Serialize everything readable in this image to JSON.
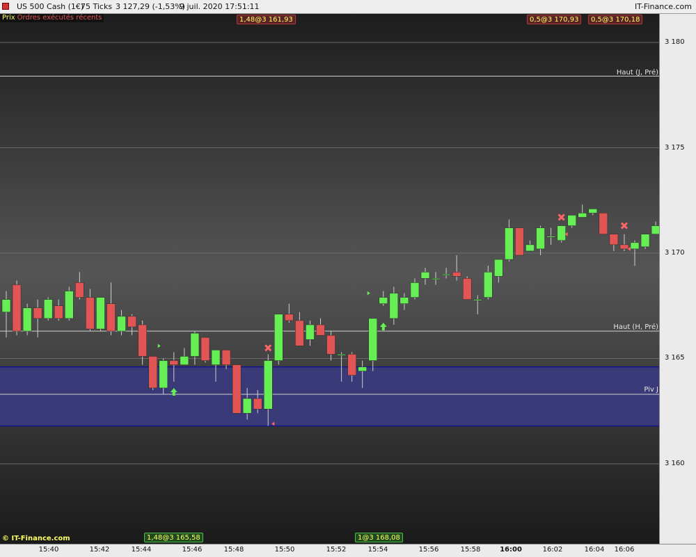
{
  "header": {
    "instrument": "US 500 Cash (1€)",
    "timeframe": "75 Ticks",
    "price": "3 127,29 (-1,53%)",
    "datetime": "9 juil. 2020 17:51:11",
    "brand": "IT-Finance.com"
  },
  "legend": {
    "price": "Prix",
    "orders": "Ordres exécutés récents"
  },
  "order_tags_top": [
    {
      "text": "1,48@3 161,93"
    },
    {
      "text": "0,5@3 170,93"
    },
    {
      "text": "0,5@3 170,18"
    }
  ],
  "order_tags_bottom": [
    {
      "text": "1,48@3 165,58"
    },
    {
      "text": "1@3 168,08"
    }
  ],
  "levels": {
    "haut_j_pre": {
      "label": "Haut (J, Pré)",
      "value": 3178.4
    },
    "haut_h_pre": {
      "label": "Haut (H, Pré)",
      "value": 3166.3
    },
    "piv_j": {
      "label": "Piv J",
      "value": 3163.3
    },
    "band": {
      "top": 3164.6,
      "bottom": 3161.8
    }
  },
  "footer_brand": "© IT-Finance.com",
  "colors": {
    "up": "#66ee55",
    "down": "#e25555",
    "band": "#3a3a78",
    "band_edge": "#14148a"
  },
  "chart_data": {
    "type": "candlestick",
    "y_ticks": [
      "3 180",
      "3 175",
      "3 170",
      "3 165",
      "3 160"
    ],
    "y_tick_values": [
      3180,
      3175,
      3170,
      3165,
      3160
    ],
    "ylim": [
      3156.0,
      3182.0
    ],
    "x_ticks": [
      "15:40",
      "15:42",
      "15:44",
      "15:46",
      "15:48",
      "15:50",
      "15:52",
      "15:54",
      "15:56",
      "15:58",
      "16:00",
      "16:02",
      "16:04",
      "16:06"
    ],
    "candles": [
      {
        "o": 3167.2,
        "h": 3168.2,
        "l": 3166.0,
        "c": 3167.8
      },
      {
        "o": 3168.5,
        "h": 3168.7,
        "l": 3166.1,
        "c": 3166.3
      },
      {
        "o": 3166.3,
        "h": 3167.6,
        "l": 3166.1,
        "c": 3167.4
      },
      {
        "o": 3167.4,
        "h": 3167.8,
        "l": 3166.0,
        "c": 3166.9
      },
      {
        "o": 3166.9,
        "h": 3167.9,
        "l": 3166.8,
        "c": 3167.8
      },
      {
        "o": 3167.5,
        "h": 3167.8,
        "l": 3166.8,
        "c": 3166.9
      },
      {
        "o": 3166.9,
        "h": 3168.4,
        "l": 3166.8,
        "c": 3168.2
      },
      {
        "o": 3168.6,
        "h": 3169.1,
        "l": 3167.8,
        "c": 3167.9
      },
      {
        "o": 3167.9,
        "h": 3168.3,
        "l": 3166.3,
        "c": 3166.4
      },
      {
        "o": 3166.4,
        "h": 3167.9,
        "l": 3166.3,
        "c": 3167.9
      },
      {
        "o": 3167.6,
        "h": 3168.6,
        "l": 3166.1,
        "c": 3166.3
      },
      {
        "o": 3166.3,
        "h": 3167.3,
        "l": 3166.1,
        "c": 3167.0
      },
      {
        "o": 3167.0,
        "h": 3167.1,
        "l": 3166.1,
        "c": 3166.5
      },
      {
        "o": 3166.6,
        "h": 3166.8,
        "l": 3164.7,
        "c": 3165.1
      },
      {
        "o": 3165.1,
        "h": 3165.1,
        "l": 3163.5,
        "c": 3163.6
      },
      {
        "o": 3163.6,
        "h": 3165.0,
        "l": 3163.3,
        "c": 3164.9
      },
      {
        "o": 3164.9,
        "h": 3165.3,
        "l": 3163.9,
        "c": 3164.7
      },
      {
        "o": 3164.7,
        "h": 3165.5,
        "l": 3164.7,
        "c": 3165.1
      },
      {
        "o": 3165.1,
        "h": 3166.3,
        "l": 3164.7,
        "c": 3166.2
      },
      {
        "o": 3166.0,
        "h": 3166.0,
        "l": 3164.8,
        "c": 3164.9
      },
      {
        "o": 3164.7,
        "h": 3165.4,
        "l": 3163.9,
        "c": 3165.4
      },
      {
        "o": 3165.4,
        "h": 3165.4,
        "l": 3164.5,
        "c": 3164.7
      },
      {
        "o": 3164.7,
        "h": 3164.7,
        "l": 3162.4,
        "c": 3162.4
      },
      {
        "o": 3162.4,
        "h": 3163.6,
        "l": 3162.1,
        "c": 3163.1
      },
      {
        "o": 3163.1,
        "h": 3163.5,
        "l": 3162.4,
        "c": 3162.6
      },
      {
        "o": 3162.6,
        "h": 3165.2,
        "l": 3161.8,
        "c": 3164.9
      },
      {
        "o": 3164.9,
        "h": 3167.1,
        "l": 3164.7,
        "c": 3167.1
      },
      {
        "o": 3167.1,
        "h": 3167.6,
        "l": 3166.7,
        "c": 3166.8
      },
      {
        "o": 3166.8,
        "h": 3167.2,
        "l": 3165.6,
        "c": 3165.6
      },
      {
        "o": 3165.9,
        "h": 3166.8,
        "l": 3165.6,
        "c": 3166.6
      },
      {
        "o": 3166.6,
        "h": 3166.9,
        "l": 3166.1,
        "c": 3166.1
      },
      {
        "o": 3166.1,
        "h": 3166.3,
        "l": 3164.9,
        "c": 3165.2
      },
      {
        "o": 3165.2,
        "h": 3165.3,
        "l": 3163.9,
        "c": 3165.2
      },
      {
        "o": 3165.2,
        "h": 3165.3,
        "l": 3163.9,
        "c": 3164.2
      },
      {
        "o": 3164.4,
        "h": 3164.9,
        "l": 3163.6,
        "c": 3164.6
      },
      {
        "o": 3164.9,
        "h": 3166.9,
        "l": 3164.4,
        "c": 3166.9
      },
      {
        "o": 3167.6,
        "h": 3168.2,
        "l": 3167.5,
        "c": 3167.9
      },
      {
        "o": 3166.9,
        "h": 3168.4,
        "l": 3166.6,
        "c": 3168.1
      },
      {
        "o": 3167.6,
        "h": 3168.1,
        "l": 3167.3,
        "c": 3167.9
      },
      {
        "o": 3167.9,
        "h": 3168.8,
        "l": 3167.8,
        "c": 3168.6
      },
      {
        "o": 3168.8,
        "h": 3169.3,
        "l": 3168.5,
        "c": 3169.1
      },
      {
        "o": 3168.8,
        "h": 3169.1,
        "l": 3168.5,
        "c": 3168.8
      },
      {
        "o": 3169.0,
        "h": 3169.3,
        "l": 3168.8,
        "c": 3169.0
      },
      {
        "o": 3169.1,
        "h": 3169.9,
        "l": 3168.7,
        "c": 3168.9
      },
      {
        "o": 3168.8,
        "h": 3168.9,
        "l": 3167.8,
        "c": 3167.8
      },
      {
        "o": 3167.8,
        "h": 3168.0,
        "l": 3167.1,
        "c": 3167.8
      },
      {
        "o": 3167.9,
        "h": 3169.4,
        "l": 3167.8,
        "c": 3169.1
      },
      {
        "o": 3168.9,
        "h": 3169.7,
        "l": 3168.6,
        "c": 3169.7
      },
      {
        "o": 3169.7,
        "h": 3171.6,
        "l": 3169.6,
        "c": 3171.2
      },
      {
        "o": 3171.2,
        "h": 3171.2,
        "l": 3169.9,
        "c": 3169.9
      },
      {
        "o": 3170.1,
        "h": 3170.6,
        "l": 3170.1,
        "c": 3170.4
      },
      {
        "o": 3170.2,
        "h": 3171.3,
        "l": 3169.9,
        "c": 3171.2
      },
      {
        "o": 3170.8,
        "h": 3171.2,
        "l": 3170.4,
        "c": 3170.8
      },
      {
        "o": 3170.6,
        "h": 3171.3,
        "l": 3170.5,
        "c": 3171.3
      },
      {
        "o": 3171.3,
        "h": 3171.8,
        "l": 3171.2,
        "c": 3171.8
      },
      {
        "o": 3171.7,
        "h": 3172.3,
        "l": 3171.7,
        "c": 3171.9
      },
      {
        "o": 3171.9,
        "h": 3172.1,
        "l": 3171.8,
        "c": 3172.1
      },
      {
        "o": 3171.9,
        "h": 3171.9,
        "l": 3170.9,
        "c": 3170.9
      },
      {
        "o": 3170.9,
        "h": 3170.9,
        "l": 3170.1,
        "c": 3170.4
      },
      {
        "o": 3170.4,
        "h": 3170.9,
        "l": 3170.1,
        "c": 3170.2
      },
      {
        "o": 3170.2,
        "h": 3170.6,
        "l": 3169.4,
        "c": 3170.5
      },
      {
        "o": 3170.3,
        "h": 3170.9,
        "l": 3170.2,
        "c": 3170.9
      },
      {
        "o": 3170.9,
        "h": 3171.5,
        "l": 3170.9,
        "c": 3171.3
      },
      {
        "o": 3171.3,
        "h": 3171.6,
        "l": 3170.9,
        "c": 3171.1
      }
    ],
    "markers": [
      {
        "type": "fill-right",
        "idx": 15,
        "price": 3165.6
      },
      {
        "type": "buy-arrow",
        "idx": 16,
        "price": 3163.4
      },
      {
        "type": "cross",
        "idx": 25,
        "price": 3165.5
      },
      {
        "type": "fill-left",
        "idx": 25,
        "price": 3161.9
      },
      {
        "type": "buy-arrow",
        "idx": 36,
        "price": 3166.5
      },
      {
        "type": "fill-right",
        "idx": 35,
        "price": 3168.1
      },
      {
        "type": "cross",
        "idx": 53,
        "price": 3171.7
      },
      {
        "type": "fill-left",
        "idx": 53,
        "price": 3170.9
      },
      {
        "type": "cross",
        "idx": 59,
        "price": 3171.3
      },
      {
        "type": "fill-left",
        "idx": 59,
        "price": 3170.2
      }
    ]
  }
}
